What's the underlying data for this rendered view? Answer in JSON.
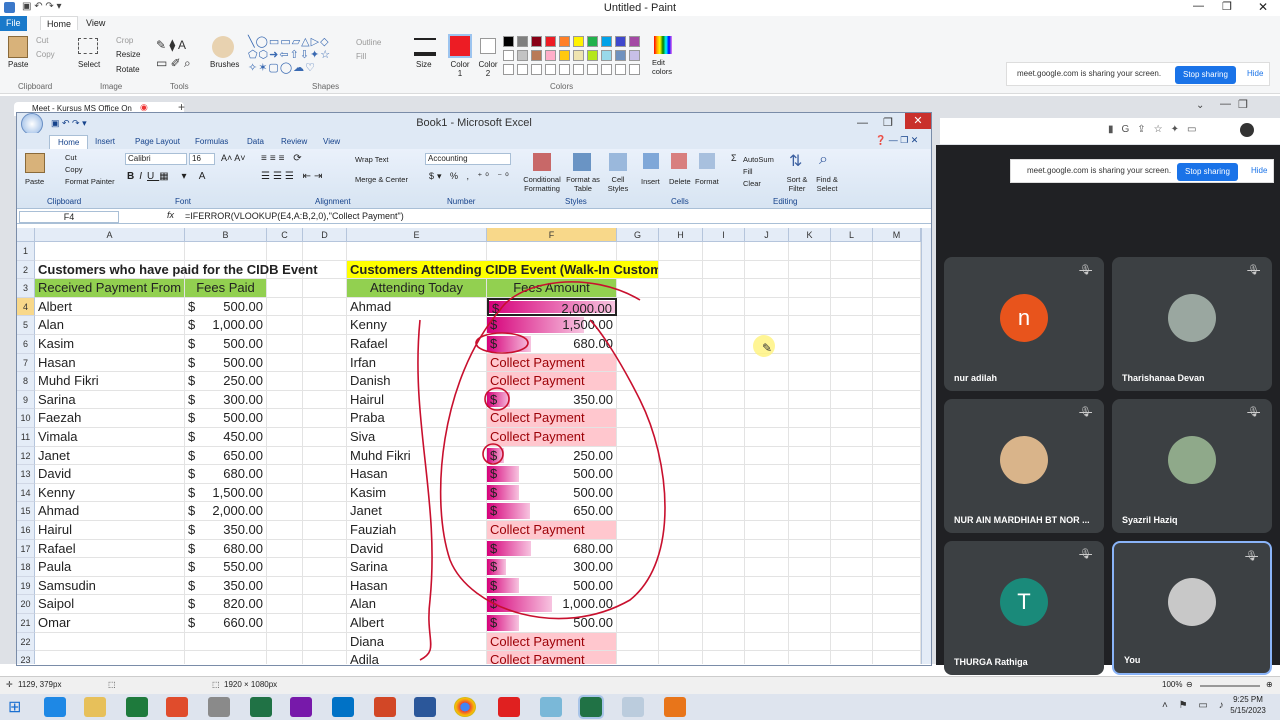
{
  "paint": {
    "title": "Untitled - Paint",
    "tabs": [
      "File",
      "Home",
      "View"
    ],
    "clipboard": {
      "paste": "Paste",
      "cut": "Cut",
      "copy": "Copy",
      "group": "Clipboard"
    },
    "image": {
      "select": "Select",
      "crop": "Crop",
      "resize": "Resize",
      "rotate": "Rotate",
      "group": "Image"
    },
    "tools_group": "Tools",
    "brushes": "Brushes",
    "shapes": {
      "outline": "Outline",
      "fill": "Fill",
      "group": "Shapes"
    },
    "size": "Size",
    "color1": "Color 1",
    "color2": "Color 2",
    "colors_group": "Colors",
    "edit_colors": "Edit colors",
    "status_pos": "1129, 379px",
    "status_size": "1920 × 1080px",
    "zoom": "100%",
    "palette": [
      "#000000",
      "#7f7f7f",
      "#880015",
      "#ed1c24",
      "#ff7f27",
      "#fff200",
      "#22b14c",
      "#00a2e8",
      "#3f48cc",
      "#a349a4",
      "#ffffff",
      "#c3c3c3",
      "#b97a57",
      "#ffaec9",
      "#ffc90e",
      "#efe4b0",
      "#b5e61d",
      "#99d9ea",
      "#7092be",
      "#c8bfe7"
    ]
  },
  "sharing": {
    "text": "meet.google.com is sharing your screen.",
    "stop": "Stop sharing",
    "hide": "Hide"
  },
  "browser_tab": {
    "title": "Meet - Kursus MS Office On"
  },
  "excel": {
    "title": "Book1 - Microsoft Excel",
    "tabs": [
      "Home",
      "Insert",
      "Page Layout",
      "Formulas",
      "Data",
      "Review",
      "View"
    ],
    "font_name": "Calibri",
    "font_size": "16",
    "number_format": "Accounting",
    "groups": [
      "Clipboard",
      "Font",
      "Alignment",
      "Number",
      "Styles",
      "Cells",
      "Editing"
    ],
    "ribbon": {
      "paste": "Paste",
      "cut": "Cut",
      "copy": "Copy",
      "format_painter": "Format Painter",
      "wrap": "Wrap Text",
      "merge": "Merge & Center",
      "cond": "Conditional Formatting",
      "fmt_table": "Format as Table",
      "cell_styles": "Cell Styles",
      "insert": "Insert",
      "delete": "Delete",
      "format": "Format",
      "autosum": "AutoSum",
      "fill": "Fill",
      "clear": "Clear",
      "sort": "Sort & Filter",
      "find": "Find & Select"
    },
    "name_box": "F4",
    "formula": "=IFERROR(VLOOKUP(E4,A:B,2,0),\"Collect Payment\")",
    "columns": [
      "A",
      "B",
      "C",
      "D",
      "E",
      "F",
      "G",
      "H",
      "I",
      "J",
      "K",
      "L",
      "M"
    ],
    "rows": [
      "1",
      "2",
      "3",
      "4",
      "5",
      "6",
      "7",
      "8",
      "9",
      "10",
      "11",
      "12",
      "13",
      "14",
      "15",
      "16",
      "17",
      "18",
      "19",
      "20",
      "21",
      "22",
      "23"
    ],
    "left_title": "Customers who have paid for the CIDB Event",
    "left_headers": [
      "Received Payment From",
      "Fees Paid"
    ],
    "paid": [
      [
        "Albert",
        "500.00"
      ],
      [
        "Alan",
        "1,000.00"
      ],
      [
        "Kasim",
        "500.00"
      ],
      [
        "Hasan",
        "500.00"
      ],
      [
        "Muhd Fikri",
        "250.00"
      ],
      [
        "Sarina",
        "300.00"
      ],
      [
        "Faezah",
        "500.00"
      ],
      [
        "Vimala",
        "450.00"
      ],
      [
        "Janet",
        "650.00"
      ],
      [
        "David",
        "680.00"
      ],
      [
        "Kenny",
        "1,500.00"
      ],
      [
        "Ahmad",
        "2,000.00"
      ],
      [
        "Hairul",
        "350.00"
      ],
      [
        "Rafael",
        "680.00"
      ],
      [
        "Paula",
        "550.00"
      ],
      [
        "Samsudin",
        "350.00"
      ],
      [
        "Saipol",
        "820.00"
      ],
      [
        "Omar",
        "660.00"
      ]
    ],
    "right_title": "Customers Attending CIDB Event (Walk-In Customers)",
    "right_headers": [
      "Attending Today",
      "Fees Amount"
    ],
    "attending": [
      [
        "Ahmad",
        "2,000.00",
        1.0
      ],
      [
        "Kenny",
        "1,500.00",
        0.75
      ],
      [
        "Rafael",
        "680.00",
        0.34
      ],
      [
        "Irfan",
        "Collect Payment",
        0
      ],
      [
        "Danish",
        "Collect Payment",
        0
      ],
      [
        "Hairul",
        "350.00",
        0.18
      ],
      [
        "Praba",
        "Collect Payment",
        0
      ],
      [
        "Siva",
        "Collect Payment",
        0
      ],
      [
        "Muhd Fikri",
        "250.00",
        0.13
      ],
      [
        "Hasan",
        "500.00",
        0.25
      ],
      [
        "Kasim",
        "500.00",
        0.25
      ],
      [
        "Janet",
        "650.00",
        0.33
      ],
      [
        "Fauziah",
        "Collect Payment",
        0
      ],
      [
        "David",
        "680.00",
        0.34
      ],
      [
        "Sarina",
        "300.00",
        0.15
      ],
      [
        "Hasan",
        "500.00",
        0.25
      ],
      [
        "Alan",
        "1,000.00",
        0.5
      ],
      [
        "Albert",
        "500.00",
        0.25
      ],
      [
        "Diana",
        "Collect Payment",
        0
      ],
      [
        "Adila",
        "Collect Payment",
        0
      ]
    ],
    "currency": "$"
  },
  "meet": {
    "participants": [
      {
        "name": "nur adilah",
        "initial": "n",
        "color": "#e8541c"
      },
      {
        "name": "Tharishanaa Devan",
        "initial": "",
        "color": "#9aa7a0"
      },
      {
        "name": "NUR AIN MARDHIAH BT NOR ...",
        "initial": "",
        "color": "#d9b48a"
      },
      {
        "name": "Syazril Haziq",
        "initial": "",
        "color": "#8fa98a"
      },
      {
        "name": "THURGA Rathiga",
        "initial": "T",
        "color": "#1a8a7a"
      },
      {
        "name": "You",
        "initial": "",
        "color": "#c8c8c8"
      }
    ]
  },
  "taskbar": {
    "time": "9:25 PM",
    "date": "5/15/2023"
  }
}
